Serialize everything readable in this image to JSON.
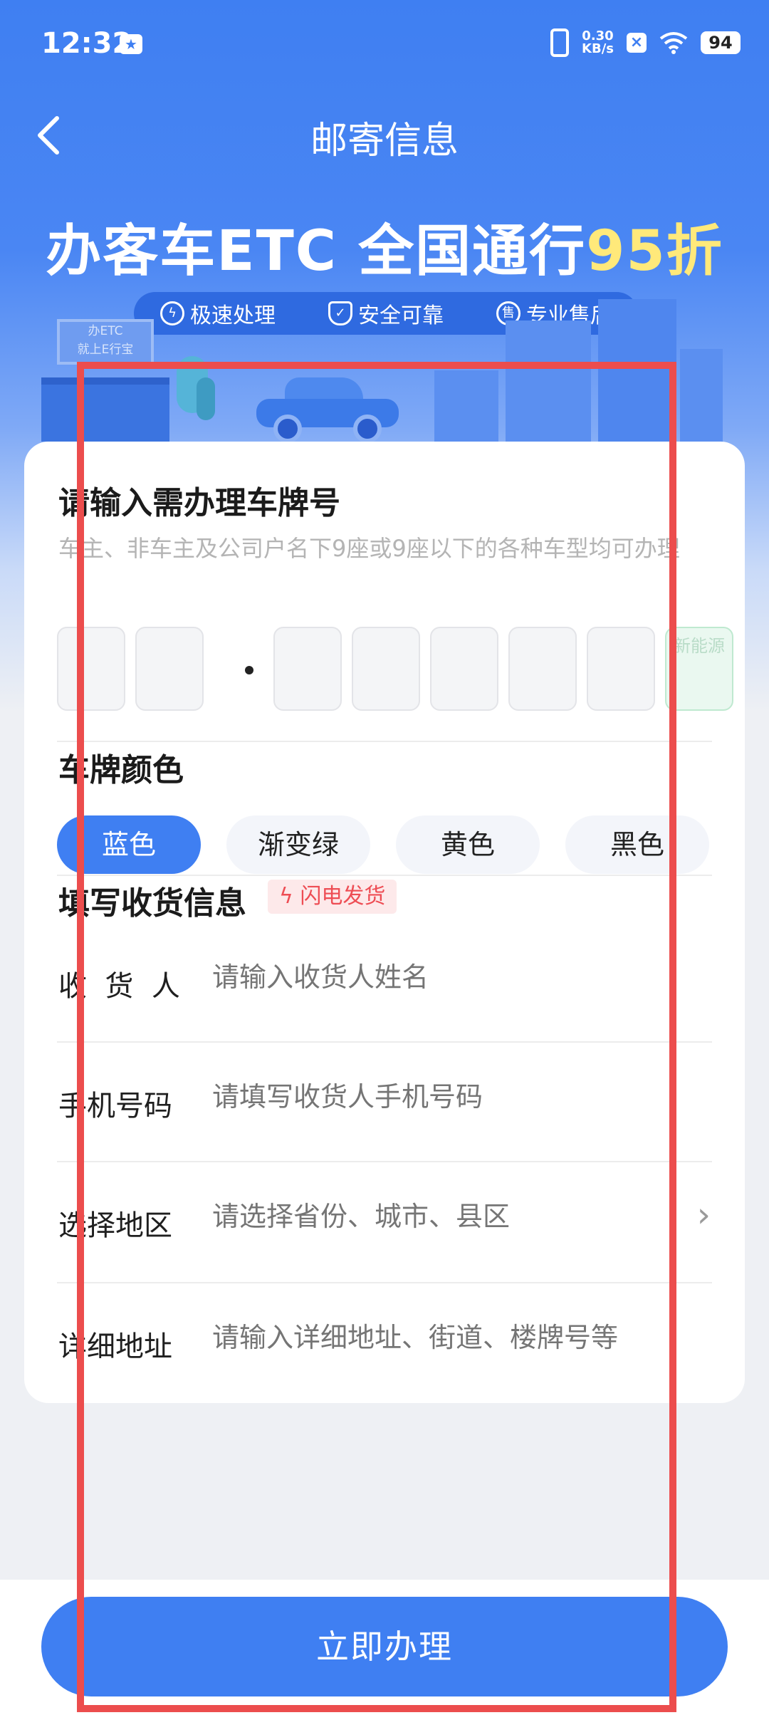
{
  "status_bar": {
    "time": "12:32",
    "speed_value": "0.30",
    "speed_unit": "KB/s",
    "battery": "94"
  },
  "nav": {
    "back_icon": "chevron-left-icon",
    "title": "邮寄信息"
  },
  "banner": {
    "title_main": "办客车ETC 全国通行",
    "title_highlight": "95折",
    "highlight_color": "#ffe97a",
    "features": [
      {
        "icon": "lightning-icon",
        "label": "极速处理"
      },
      {
        "icon": "shield-icon",
        "label": "安全可靠"
      },
      {
        "icon": "service-icon",
        "label": "专业售后"
      }
    ],
    "sign_text_line1": "办ETC",
    "sign_text_line2": "就上E行宝"
  },
  "plate_section": {
    "title": "请输入需办理车牌号",
    "description": "车主、非车主及公司户名下9座或9座以下的各种车型均可办理",
    "new_energy_label": "新能源"
  },
  "color_section": {
    "title": "车牌颜色",
    "options": [
      "蓝色",
      "渐变绿",
      "黄色",
      "黑色"
    ],
    "selected": "蓝色"
  },
  "shipping_section": {
    "title": "填写收货信息",
    "badge": "闪电发货",
    "fields": [
      {
        "label": "收  货  人",
        "placeholder": "请输入收货人姓名"
      },
      {
        "label": "手机号码",
        "placeholder": "请填写收货人手机号码"
      },
      {
        "label": "选择地区",
        "placeholder": "请选择省份、城市、县区"
      },
      {
        "label": "详细地址",
        "placeholder": "请输入详细地址、街道、楼牌号等"
      }
    ]
  },
  "footer": {
    "submit_label": "立即办理"
  },
  "colors": {
    "accent": "#3f7ff2",
    "badge_red": "#ee4d54",
    "highlight_frame": "#ec4d4d"
  }
}
